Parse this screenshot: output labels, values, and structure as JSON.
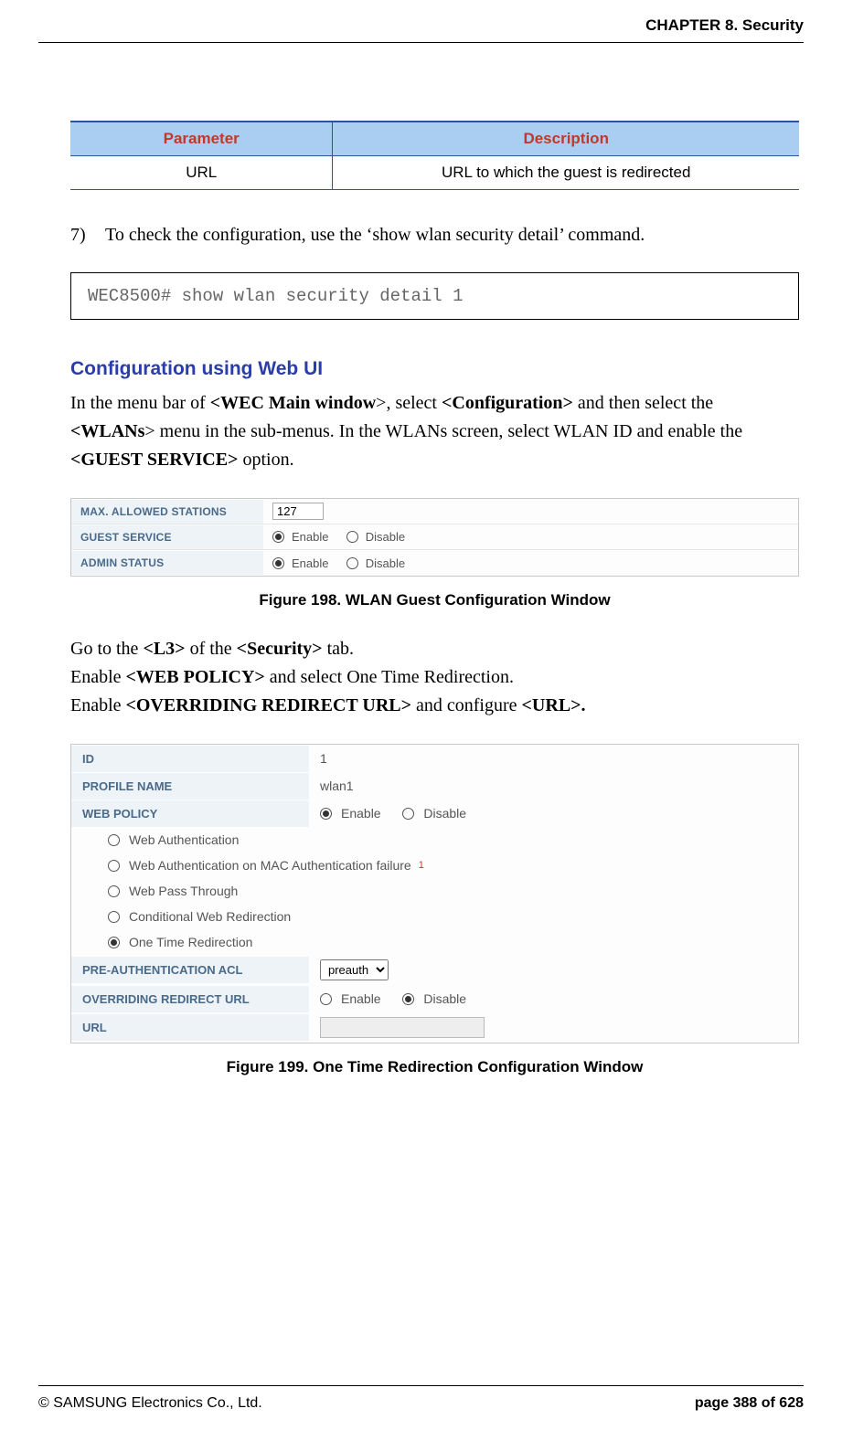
{
  "header": {
    "running": "CHAPTER 8. Security"
  },
  "table": {
    "head": {
      "param": "Parameter",
      "desc": "Description"
    },
    "row": {
      "param": "URL",
      "desc": "URL to which the guest is redirected"
    }
  },
  "step": {
    "num": "7)",
    "text": "To check the configuration, use the ‘show wlan security detail’ command."
  },
  "code": "WEC8500# show wlan security detail 1",
  "section_title": "Configuration using Web UI",
  "para1": {
    "pre_bold1": "In the menu bar of ",
    "bold1": "<WEC Main window",
    "after_bold1": ">, select ",
    "bold2": "<Configuration>",
    "after_bold2": " and then select the ",
    "bold3": "<WLANs",
    "after_bold3": "> menu in the sub-menus. In the WLANs screen, select WLAN ID and enable the ",
    "bold4": "<GUEST SERVICE>",
    "after_bold4": " option."
  },
  "fig1": {
    "rows": {
      "max": "MAX. ALLOWED STATIONS",
      "max_val": "127",
      "guest": "GUEST SERVICE",
      "admin": "ADMIN STATUS"
    },
    "enable": "Enable",
    "disable": "Disable",
    "caption": "Figure 198. WLAN Guest Configuration Window"
  },
  "para2": {
    "l1_pre": "Go to the ",
    "l1_b1": "<L3>",
    "l1_mid": " of the ",
    "l1_b2": "<Security>",
    "l1_post": " tab.",
    "l2_pre": "Enable ",
    "l2_b1": "<WEB POLICY>",
    "l2_post": " and select One Time Redirection.",
    "l3_pre": "Enable ",
    "l3_b1": "<OVERRIDING REDIRECT URL>",
    "l3_mid": " and configure ",
    "l3_b2": "<URL>."
  },
  "fig2": {
    "id_label": "ID",
    "id_value": "1",
    "profile_label": "PROFILE NAME",
    "profile_value": "wlan1",
    "webpolicy_label": "WEB POLICY",
    "enable": "Enable",
    "disable": "Disable",
    "opts": {
      "o1": "Web Authentication",
      "o2": "Web Authentication on MAC Authentication failure",
      "o3": "Web Pass Through",
      "o4": "Conditional Web Redirection",
      "o5": "One Time Redirection"
    },
    "preauth_label": "PRE-AUTHENTICATION ACL",
    "preauth_value": "preauth",
    "redirect_label": "OVERRIDING REDIRECT URL",
    "url_label": "URL",
    "caption": "Figure 199. One Time Redirection Configuration Window"
  },
  "footer": {
    "copyright": "© SAMSUNG Electronics Co., Ltd.",
    "page": "page 388 of 628"
  }
}
